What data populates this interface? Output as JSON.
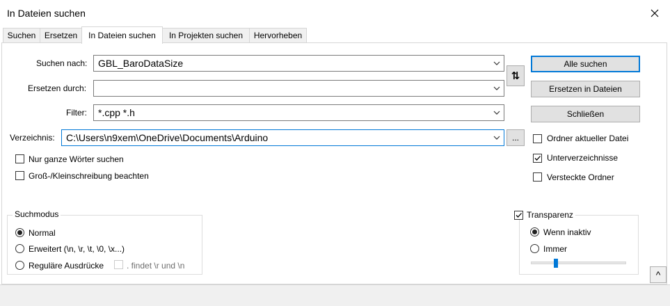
{
  "window": {
    "title": "In Dateien suchen"
  },
  "tabs": [
    {
      "label": "Suchen"
    },
    {
      "label": "Ersetzen"
    },
    {
      "label": "In Dateien suchen"
    },
    {
      "label": "In Projekten suchen"
    },
    {
      "label": "Hervorheben"
    }
  ],
  "fields": {
    "find": {
      "label": "Suchen nach:",
      "value": "GBL_BaroDataSize"
    },
    "replace": {
      "label": "Ersetzen durch:",
      "value": ""
    },
    "filter": {
      "label": "Filter:",
      "value": "*.cpp *.h"
    },
    "directory": {
      "label": "Verzeichnis:",
      "value": "C:\\Users\\n9xem\\OneDrive\\Documents\\Arduino"
    }
  },
  "buttons": {
    "swap": "⇅",
    "browse": "...",
    "find_all": "Alle suchen",
    "replace_in_files": "Ersetzen in Dateien",
    "close": "Schließen",
    "collapse": "^"
  },
  "options": {
    "whole_word": {
      "label": "Nur ganze Wörter suchen",
      "checked": false
    },
    "match_case": {
      "label": "Groß-/Kleinschreibung beachten",
      "checked": false
    },
    "follow_current_doc": {
      "label": "Ordner aktueller Datei",
      "checked": false
    },
    "sub_folders": {
      "label": "Unterverzeichnisse",
      "checked": true
    },
    "hidden_folders": {
      "label": "Versteckte Ordner",
      "checked": false
    }
  },
  "search_mode": {
    "title": "Suchmodus",
    "normal": {
      "label": "Normal",
      "selected": true
    },
    "extended": {
      "label": "Erweitert (\\n, \\r, \\t, \\0, \\x...)",
      "selected": false
    },
    "regex": {
      "label": "Reguläre Ausdrücke",
      "selected": false
    },
    "dot_newline": {
      "label": ". findet \\r und \\n",
      "checked": false
    }
  },
  "transparency": {
    "title": "Transparenz",
    "checked": true,
    "on_lose_focus": {
      "label": "Wenn inaktiv",
      "selected": true
    },
    "always": {
      "label": "Immer",
      "selected": false
    },
    "level": 0.25
  },
  "colors": {
    "accent": "#0078d7",
    "button_bg": "#e1e1e1"
  }
}
